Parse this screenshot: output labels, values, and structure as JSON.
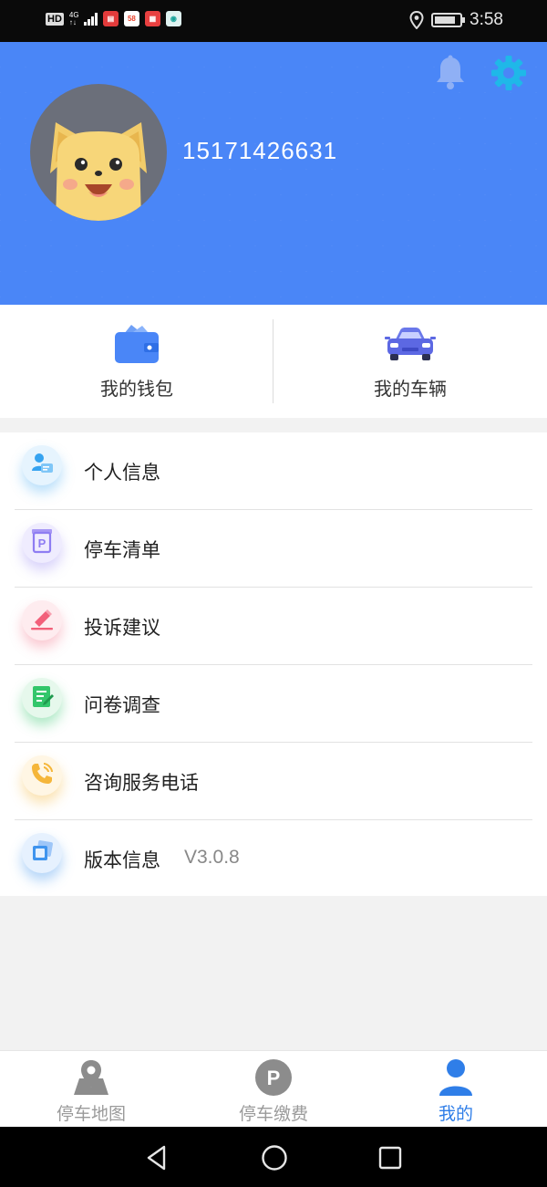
{
  "status_bar": {
    "hd": "HD",
    "network_top": "4G",
    "network_bottom": "↑↓",
    "app_badge_58": "58",
    "time": "3:58"
  },
  "header": {
    "phone_number": "15171426631",
    "bg_color": "#4a86f7",
    "icons": [
      "bell-icon",
      "gear-icon"
    ]
  },
  "quick": {
    "wallet_label": "我的钱包",
    "vehicle_label": "我的车辆"
  },
  "menu": {
    "items": [
      {
        "label": "个人信息",
        "icon": "id-card-icon",
        "color": "#36a3f0"
      },
      {
        "label": "停车清单",
        "icon": "parking-list-icon",
        "color": "#8e7df2"
      },
      {
        "label": "投诉建议",
        "icon": "edit-pen-icon",
        "color": "#f2607a"
      },
      {
        "label": "问卷调查",
        "icon": "survey-icon",
        "color": "#33c66b"
      },
      {
        "label": "咨询服务电话",
        "icon": "phone-icon",
        "color": "#f5b63a"
      },
      {
        "label": "版本信息",
        "icon": "version-icon",
        "color": "#3f94ee",
        "extra": "V3.0.8"
      }
    ]
  },
  "bottom_nav": {
    "tabs": [
      {
        "label": "停车地图",
        "icon": "map-pin-icon",
        "active": false
      },
      {
        "label": "停车缴费",
        "icon": "parking-p-icon",
        "active": false
      },
      {
        "label": "我的",
        "icon": "user-icon",
        "active": true
      }
    ],
    "active_color": "#2f7ee8"
  }
}
